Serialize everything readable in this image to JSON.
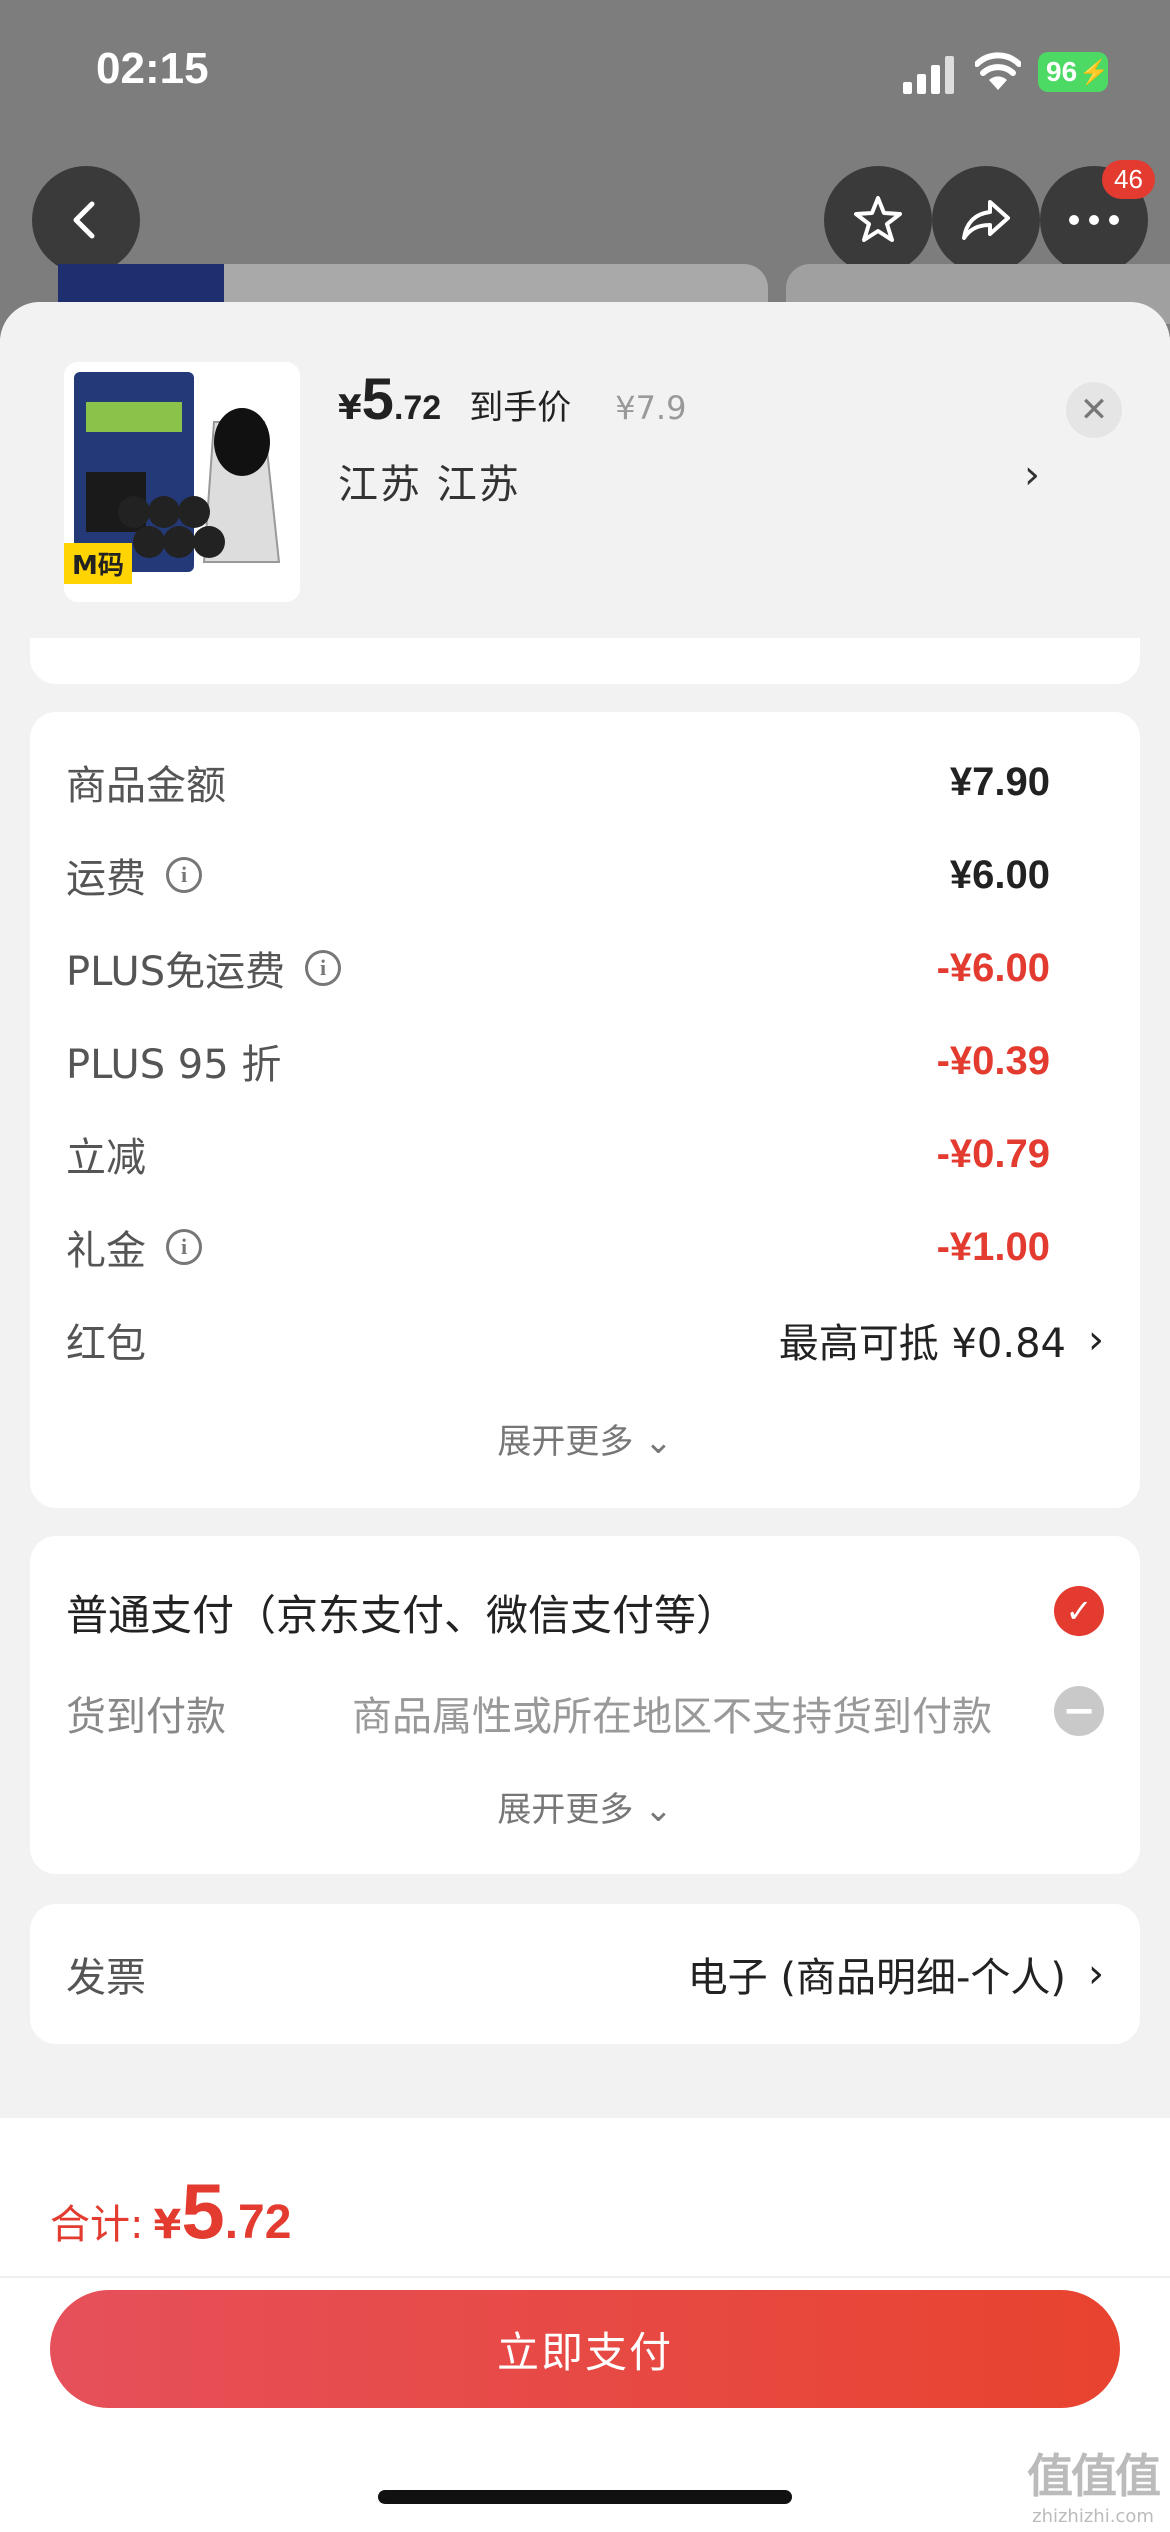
{
  "status_bar": {
    "time": "02:15",
    "battery": "96"
  },
  "top_actions": {
    "badge": "46"
  },
  "product": {
    "thumb_tag": "M码",
    "price_yen": "¥",
    "price_int": "5",
    "price_dec": ".72",
    "price_label": "到手价",
    "original_price": "¥7.9",
    "region": "江苏  江苏"
  },
  "fees": {
    "rows": [
      {
        "label": "商品金额",
        "value": "¥7.90"
      },
      {
        "label": "运费",
        "value": "¥6.00"
      },
      {
        "label": "PLUS免运费",
        "value": "-¥6.00"
      },
      {
        "label": "PLUS 95 折",
        "value": "-¥0.39"
      },
      {
        "label": "立减",
        "value": "-¥0.79"
      },
      {
        "label": "礼金",
        "value": "-¥1.00"
      },
      {
        "label": "红包",
        "value": "最高可抵 ¥0.84"
      }
    ],
    "expand_label": "展开更多"
  },
  "payment": {
    "normal_label": "普通支付（京东支付、微信支付等）",
    "cod_label": "货到付款",
    "cod_desc": "商品属性或所在地区不支持货到付款",
    "expand_label": "展开更多"
  },
  "invoice": {
    "label": "发票",
    "value": "电子 (商品明细-个人)"
  },
  "footer": {
    "total_label": "合计:",
    "total_yen": "¥",
    "total_int": "5",
    "total_dec": ".72",
    "pay_button": "立即支付"
  },
  "watermark": {
    "title": "值值值",
    "url": "zhizhizhi.com"
  }
}
